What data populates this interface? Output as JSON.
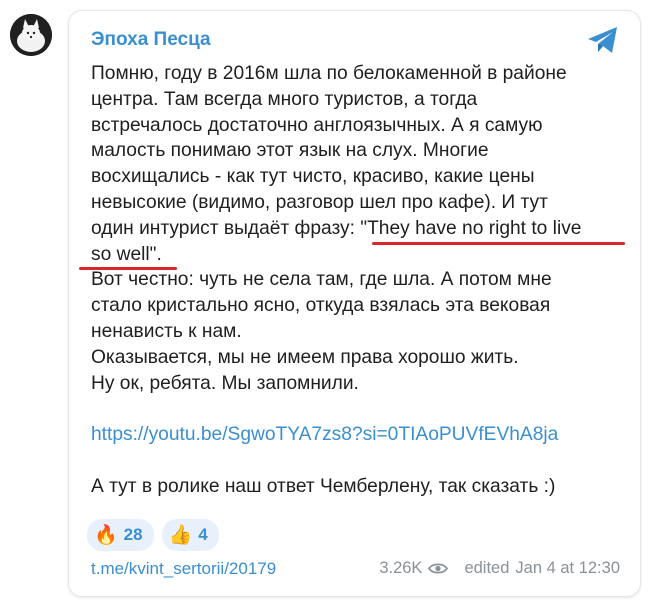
{
  "post": {
    "channel_name": "Эпоха Песца",
    "lines": {
      "l1": "Помню, году в 2016м шла по белокаменной в районе",
      "l2": "центра. Там всегда много туристов, а тогда",
      "l3": "встречалось достаточно англоязычных. А я самую",
      "l4": "малость понимаю этот язык на слух. Многие",
      "l5": "восхищались - как тут чисто, красиво, какие цены",
      "l6": "невысокие (видимо, разговор шел про кафе). И тут",
      "l7": "один интурист выдаёт фразу: \"They have no right to live",
      "l8": "so well\".",
      "l9": "Вот честно: чуть не села там, где шла. А потом мне",
      "l10": "стало кристально ясно, откуда взялась эта вековая",
      "l11": "ненависть к нам.",
      "l12": "Оказывается, мы не имеем права хорошо жить.",
      "l13": "Ну ок, ребята. Мы запомнили."
    },
    "video_link": "https://youtu.be/SgwoTYA7zs8?si=0TIAoPUVfEVhA8ja",
    "closing_line": "А тут в ролике наш ответ Чемберлену, так сказать :)",
    "reactions": [
      {
        "emoji": "🔥",
        "icon": "fire-emoji",
        "count": "28"
      },
      {
        "emoji": "👍",
        "icon": "thumbs-up-emoji",
        "count": "4"
      }
    ],
    "post_link": "t.me/kvint_sertorii/20179",
    "views": "3.26K",
    "edited_label": "edited",
    "date": "Jan 4 at 12:30"
  },
  "colors": {
    "accent": "#3a8fd0",
    "underline": "#d8262b",
    "reaction_bg": "#e8f1fb",
    "meta_text": "#8a9198"
  }
}
